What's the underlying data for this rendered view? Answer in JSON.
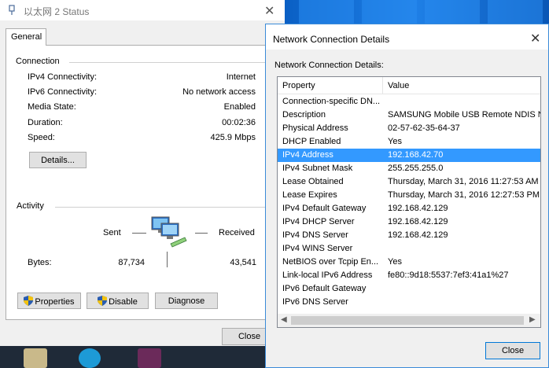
{
  "status_window": {
    "title": "以太网 2 Status",
    "close_glyph": "✕",
    "tab_general": "General",
    "connection_label": "Connection",
    "rows": [
      {
        "label": "IPv4 Connectivity:",
        "value": "Internet"
      },
      {
        "label": "IPv6 Connectivity:",
        "value": "No network access"
      },
      {
        "label": "Media State:",
        "value": "Enabled"
      },
      {
        "label": "Duration:",
        "value": "00:02:36"
      },
      {
        "label": "Speed:",
        "value": "425.9 Mbps"
      }
    ],
    "details_button": "Details...",
    "activity_label": "Activity",
    "sent_label": "Sent",
    "received_label": "Received",
    "bytes_label": "Bytes:",
    "bytes_sent": "87,734",
    "bytes_received": "43,541",
    "properties_button": "Properties",
    "disable_button": "Disable",
    "diagnose_button": "Diagnose",
    "close_button": "Close"
  },
  "details_window": {
    "title": "Network Connection Details",
    "close_glyph": "✕",
    "caption": "Network Connection Details:",
    "col_property": "Property",
    "col_value": "Value",
    "rows": [
      {
        "property": "Connection-specific DN...",
        "value": ""
      },
      {
        "property": "Description",
        "value": "SAMSUNG Mobile USB Remote NDIS Ne"
      },
      {
        "property": "Physical Address",
        "value": "02-57-62-35-64-37"
      },
      {
        "property": "DHCP Enabled",
        "value": "Yes"
      },
      {
        "property": "IPv4 Address",
        "value": "192.168.42.70"
      },
      {
        "property": "IPv4 Subnet Mask",
        "value": "255.255.255.0"
      },
      {
        "property": "Lease Obtained",
        "value": "Thursday, March 31, 2016 11:27:53 AM"
      },
      {
        "property": "Lease Expires",
        "value": "Thursday, March 31, 2016 12:27:53 PM"
      },
      {
        "property": "IPv4 Default Gateway",
        "value": "192.168.42.129"
      },
      {
        "property": "IPv4 DHCP Server",
        "value": "192.168.42.129"
      },
      {
        "property": "IPv4 DNS Server",
        "value": "192.168.42.129"
      },
      {
        "property": "IPv4 WINS Server",
        "value": ""
      },
      {
        "property": "NetBIOS over Tcpip En...",
        "value": "Yes"
      },
      {
        "property": "Link-local IPv6 Address",
        "value": "fe80::9d18:5537:7ef3:41a1%27"
      },
      {
        "property": "IPv6 Default Gateway",
        "value": ""
      },
      {
        "property": "IPv6 DNS Server",
        "value": ""
      }
    ],
    "selected_row": 4,
    "close_button": "Close"
  },
  "colors": {
    "selection": "#3399ff",
    "window_border": "#3a8ad8",
    "desktop": "#1e7fe6"
  }
}
